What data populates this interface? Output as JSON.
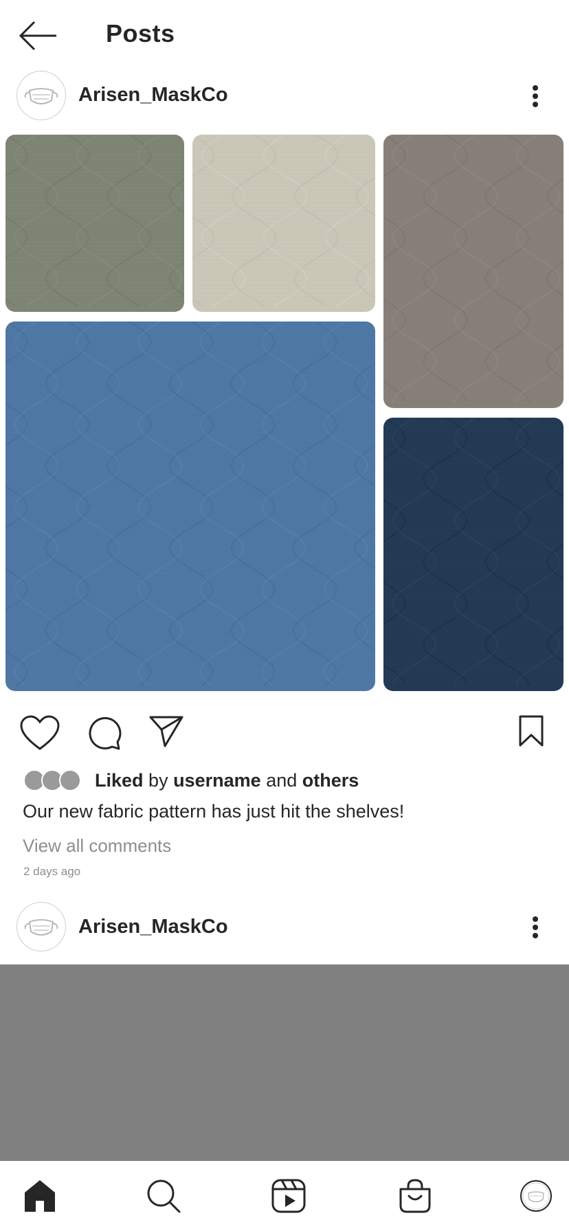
{
  "header": {
    "title": "Posts",
    "back_icon": "arrow-left-icon"
  },
  "posts": [
    {
      "username": "Arisen_MaskCo",
      "menu_icon": "more-vertical-icon",
      "swatches": [
        {
          "color": "#7e8473"
        },
        {
          "color": "#cac6b7"
        },
        {
          "color": "#867f77"
        },
        {
          "color": "#4f77a3"
        },
        {
          "color": "#233a55"
        }
      ],
      "actions": {
        "like_icon": "heart-icon",
        "comment_icon": "comment-icon",
        "share_icon": "send-icon",
        "save_icon": "bookmark-icon"
      },
      "likes": {
        "liked": "Liked",
        "by": "by",
        "username": "username",
        "and": "and",
        "others": "others"
      },
      "caption": "Our new fabric pattern has just hit the shelves!",
      "view_comments": "View all comments",
      "time_ago": "2 days ago"
    },
    {
      "username": "Arisen_MaskCo",
      "menu_icon": "more-vertical-icon"
    }
  ],
  "tabbar": {
    "items": [
      {
        "icon": "home-icon",
        "active": true
      },
      {
        "icon": "search-icon"
      },
      {
        "icon": "reels-icon"
      },
      {
        "icon": "shop-icon"
      },
      {
        "icon": "profile-avatar-icon"
      }
    ]
  },
  "colors": {
    "text": "#262626",
    "secondary_text": "#8e8e8e",
    "placeholder": "#808080"
  }
}
